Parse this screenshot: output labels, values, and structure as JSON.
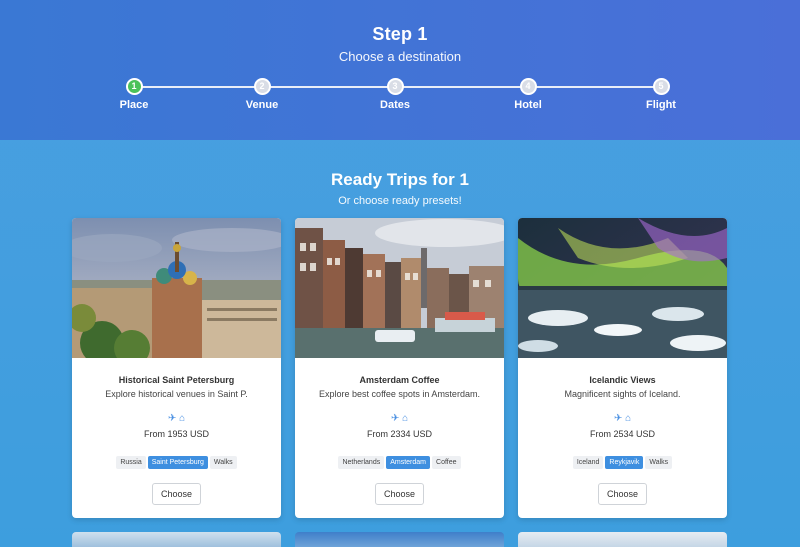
{
  "header": {
    "title": "Step 1",
    "subtitle": "Choose a destination"
  },
  "stepper": [
    {
      "num": "1",
      "label": "Place",
      "active": true
    },
    {
      "num": "2",
      "label": "Venue",
      "active": false
    },
    {
      "num": "3",
      "label": "Dates",
      "active": false
    },
    {
      "num": "4",
      "label": "Hotel",
      "active": false
    },
    {
      "num": "5",
      "label": "Flight",
      "active": false
    }
  ],
  "ready": {
    "title": "Ready Trips for 1",
    "subtitle": "Or choose ready presets!"
  },
  "cards": [
    {
      "name": "Historical Saint Petersburg",
      "desc": "Explore historical venues in Saint P.",
      "icons": "plane-icon bed-icon",
      "price": "From 1953 USD",
      "tags": [
        "Russia",
        "Saint Petersburg",
        "Walks"
      ],
      "active_tag": 1,
      "button": "Choose"
    },
    {
      "name": "Amsterdam Coffee",
      "desc": "Explore best coffee spots in Amsterdam.",
      "icons": "plane-icon bed-icon",
      "price": "From 2334 USD",
      "tags": [
        "Netherlands",
        "Amsterdam",
        "Coffee"
      ],
      "active_tag": 1,
      "button": "Choose"
    },
    {
      "name": "Icelandic Views",
      "desc": "Magnificent sights of Iceland.",
      "icons": "plane-icon bed-icon",
      "price": "From 2534 USD",
      "tags": [
        "Iceland",
        "Reykjavik",
        "Walks"
      ],
      "active_tag": 1,
      "button": "Choose"
    }
  ],
  "colors": {
    "accent": "#3e8fe0",
    "active_step": "#4cc25a"
  }
}
